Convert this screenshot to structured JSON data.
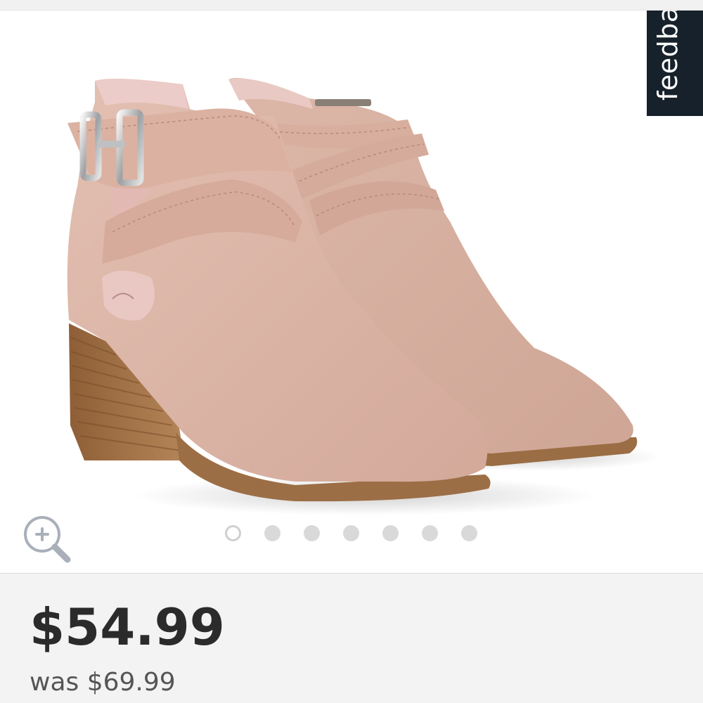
{
  "feedback_tab": {
    "label": "feedba"
  },
  "gallery": {
    "image": {
      "alt": "Pair of blush suede ankle booties with crossover strap, side buckle and stacked wood block heel"
    },
    "zoom_icon": "zoom-in-icon",
    "dots": {
      "count": 7,
      "active_index": 0
    }
  },
  "pricing": {
    "current": "$54.99",
    "was": "was $69.99"
  },
  "colors": {
    "feedback_bg": "#17212b",
    "suede": "#dcb5a6",
    "heel": "#a8774a",
    "price_text": "#2b2b2b"
  }
}
